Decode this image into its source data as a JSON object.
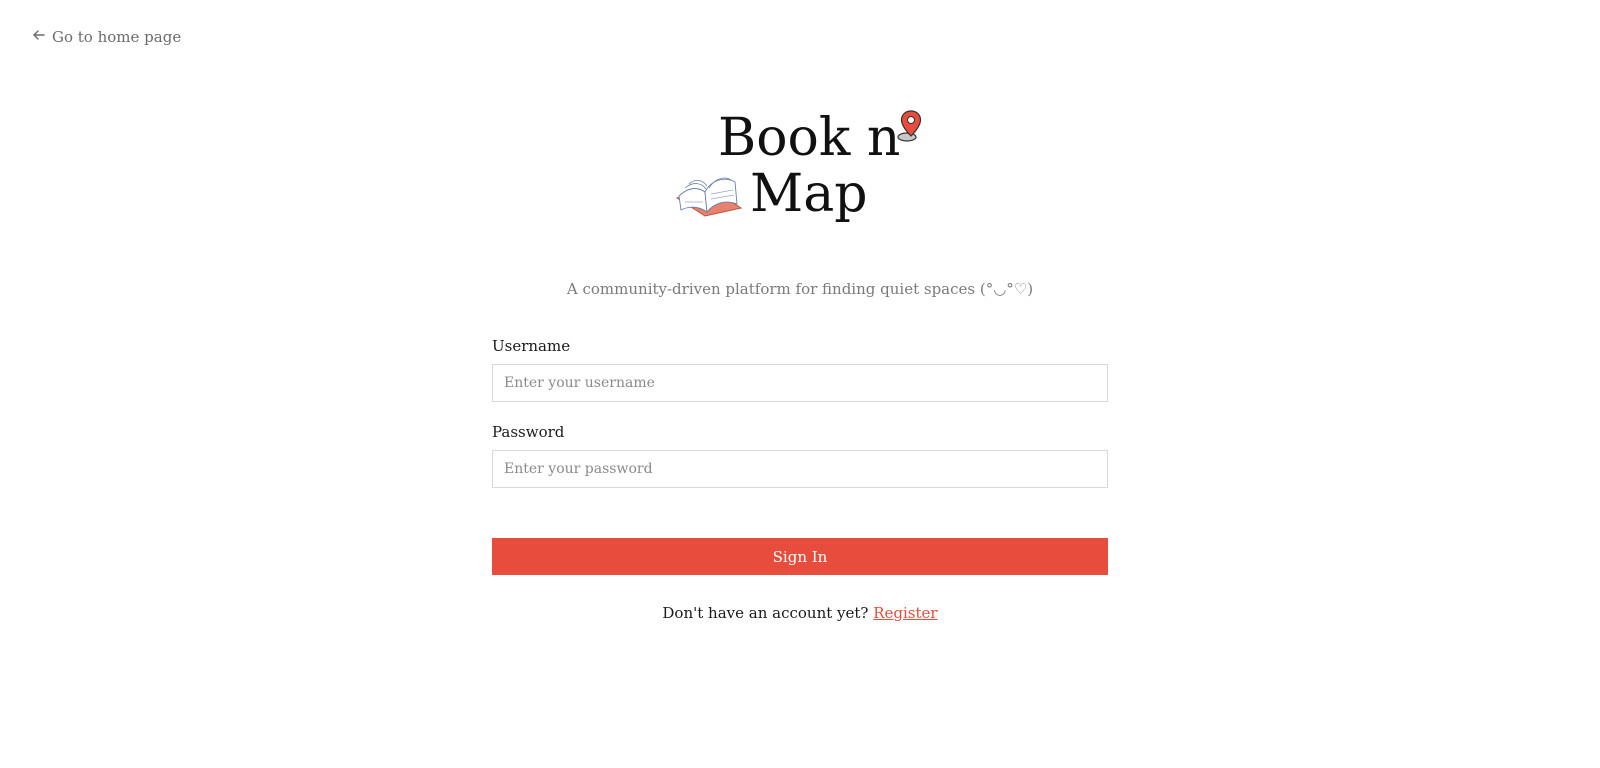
{
  "nav": {
    "back_label": "Go to home page"
  },
  "logo": {
    "line1": "Book n",
    "line2": "Map"
  },
  "tagline": "A community-driven platform for finding quiet spaces (°◡°♡)",
  "form": {
    "username_label": "Username",
    "username_placeholder": "Enter your username",
    "username_value": "",
    "password_label": "Password",
    "password_placeholder": "Enter your password",
    "password_value": "",
    "submit_label": "Sign In"
  },
  "footer": {
    "prompt": "Don't have an account yet?",
    "register_label": "Register"
  },
  "colors": {
    "accent": "#e74c3c",
    "muted_text": "#7a7a7a",
    "border": "#d8d8d8"
  },
  "icons": {
    "back": "arrow-left-icon",
    "pin": "map-pin-icon",
    "book": "open-book-icon"
  }
}
